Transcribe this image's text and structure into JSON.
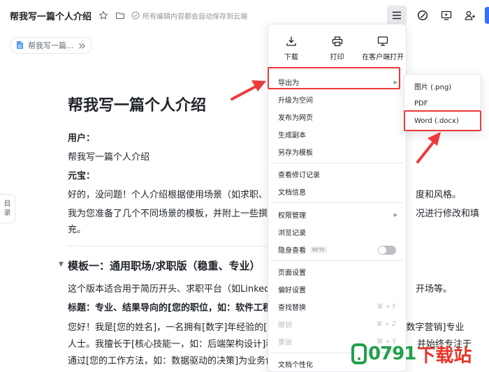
{
  "header": {
    "title": "帮我写一篇个人介绍",
    "save_status": "所有编辑内容都会自动保存到云端"
  },
  "breadcrumb": {
    "label": "帮我写一篇..."
  },
  "outline_tab": {
    "line1": "目",
    "line2": "录"
  },
  "document": {
    "heading": "帮我写一篇个人介绍",
    "user_label": "用户：",
    "user_message": "帮我写一篇个人介绍",
    "bot_label": "元宝：",
    "reply_1": "好的，没问题！个人介绍根据使用场景（如求职、",
    "reply_1_tail": "度和风格。",
    "reply_2": "我为您准备了几个不同场景的模板，并附上一些撰",
    "reply_2_tail": "况进行修改和填",
    "reply_3": "充。",
    "section_title": "模板一：通用职场/求职版（稳重、专业）",
    "section_p1": "这个版本适合用于简历开头、求职平台（如Linked",
    "section_p1_tail": "开场等。",
    "section_title_line": "标题：专业、结果导向的[您的职位，如：软件工程",
    "body_1": "您好！我是[您的姓名]，一名拥有[数字]年经验的[",
    "body_1_tail": "/数字营销]专业",
    "body_2": "人士。我擅长于[核心技能一，如：后端架构设计]和",
    "body_2_tail": "并始终专注于",
    "body_3": "通过[您的工作方法，如：数据驱动的决策]为业务创"
  },
  "menu": {
    "quick_actions": [
      "下载",
      "打印",
      "在客户端打开"
    ],
    "group1": [
      "导出为",
      "升级为空间",
      "发布为网页",
      "生成副本",
      "另存为模板"
    ],
    "group2": [
      "查看修订记录",
      "文档信息"
    ],
    "group3": [
      "权限管理",
      "浏览记录",
      "隐身查看"
    ],
    "beta_badge": "BETA",
    "group4": [
      "页面设置",
      "偏好设置",
      "查找替换",
      "撤销",
      "重做"
    ],
    "shortcuts": {
      "find_replace": "⌘ + F",
      "undo": "⌘ + Z",
      "redo": "⌘ + Y"
    },
    "group5": [
      "文档个性化"
    ],
    "incognito_on": false
  },
  "submenu": {
    "items": [
      "图片 (.png)",
      "PDF",
      "Word (.docx)"
    ]
  },
  "watermark": {
    "number": "0791",
    "text": "下载站"
  },
  "colors": {
    "highlight_red": "#ee3a3a",
    "accent_blue": "#3370ff",
    "watermark_green": "#22a04a",
    "watermark_red": "#e83428"
  }
}
